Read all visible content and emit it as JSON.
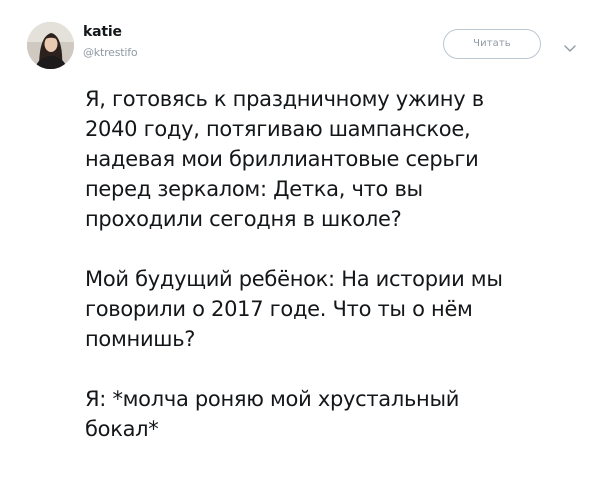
{
  "tweet": {
    "author": {
      "name": "katie",
      "handle": "@ktrestifo"
    },
    "follow_label": "Читать",
    "paragraphs": [
      [
        "Я, готовясь к праздничному ужину в",
        "2040 году, потягиваю шампанское,",
        "надевая мои бриллиантовые серьги",
        "перед зеркалом: Детка, что вы",
        "проходили сегодня в школе?"
      ],
      [
        "Мой будущий ребёнок: На истории мы",
        "говорили о 2017 годе. Что ты о нём",
        "помнишь?"
      ],
      [
        "Я: *молча роняю мой хрустальный",
        "бокал*"
      ]
    ]
  },
  "icons": {
    "menu": "chevron-down-icon",
    "avatar": "profile-photo"
  },
  "colors": {
    "text": "#14171a",
    "secondary": "#8f9aa4",
    "button_border": "#bcc7d0"
  }
}
